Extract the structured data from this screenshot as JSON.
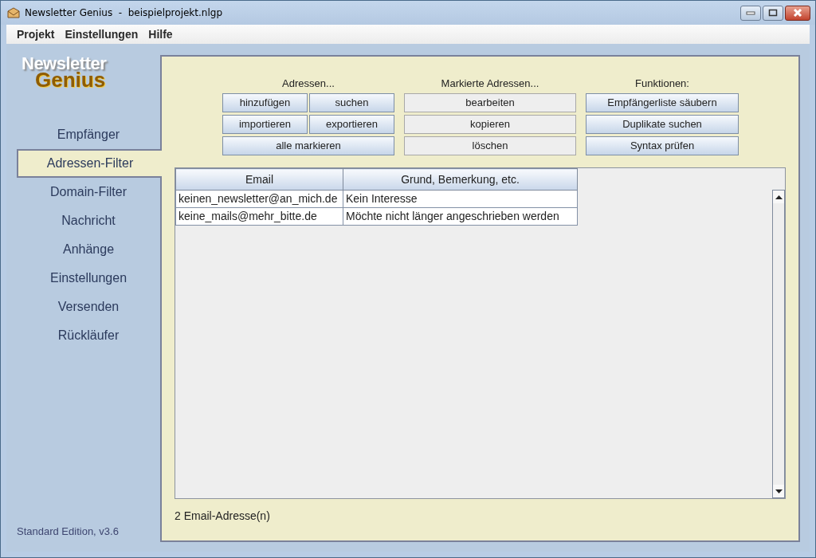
{
  "window": {
    "title": "Newsletter Genius  -  beispielprojekt.nlgp"
  },
  "menu": [
    "Projekt",
    "Einstellungen",
    "Hilfe"
  ],
  "logo": {
    "line_1": "Newsletter",
    "line_2": "Genius"
  },
  "sidebar": {
    "items": [
      {
        "label": "Empfänger",
        "selected": false
      },
      {
        "label": "Adressen-Filter",
        "selected": true
      },
      {
        "label": "Domain-Filter",
        "selected": false
      },
      {
        "label": "Nachricht",
        "selected": false
      },
      {
        "label": "Anhänge",
        "selected": false
      },
      {
        "label": "Einstellungen",
        "selected": false
      },
      {
        "label": "Versenden",
        "selected": false
      },
      {
        "label": "Rückläufer",
        "selected": false
      }
    ],
    "edition": "Standard Edition, v3.6"
  },
  "button_groups": [
    {
      "title": "Adressen...",
      "rows": [
        [
          {
            "label": "hinzufügen",
            "disabled": false
          },
          {
            "label": "suchen",
            "disabled": false
          }
        ],
        [
          {
            "label": "importieren",
            "disabled": false
          },
          {
            "label": "exportieren",
            "disabled": false
          }
        ],
        [
          {
            "label": "alle markieren",
            "disabled": false
          }
        ]
      ]
    },
    {
      "title": "Markierte Adressen...",
      "rows": [
        [
          {
            "label": "bearbeiten",
            "disabled": true
          }
        ],
        [
          {
            "label": "kopieren",
            "disabled": true
          }
        ],
        [
          {
            "label": "löschen",
            "disabled": true
          }
        ]
      ]
    },
    {
      "title": "Funktionen:",
      "rows": [
        [
          {
            "label": "Empfängerliste säubern",
            "disabled": false
          }
        ],
        [
          {
            "label": "Duplikate suchen",
            "disabled": false
          }
        ],
        [
          {
            "label": "Syntax prüfen",
            "disabled": false
          }
        ]
      ]
    }
  ],
  "table": {
    "columns": [
      "Email",
      "Grund, Bemerkung, etc."
    ],
    "rows": [
      [
        "keinen_newsletter@an_mich.de",
        "Kein Interesse"
      ],
      [
        "keine_mails@mehr_bitte.de",
        "Möchte nicht länger angeschrieben werden"
      ]
    ]
  },
  "status": "2 Email-Adresse(n)"
}
